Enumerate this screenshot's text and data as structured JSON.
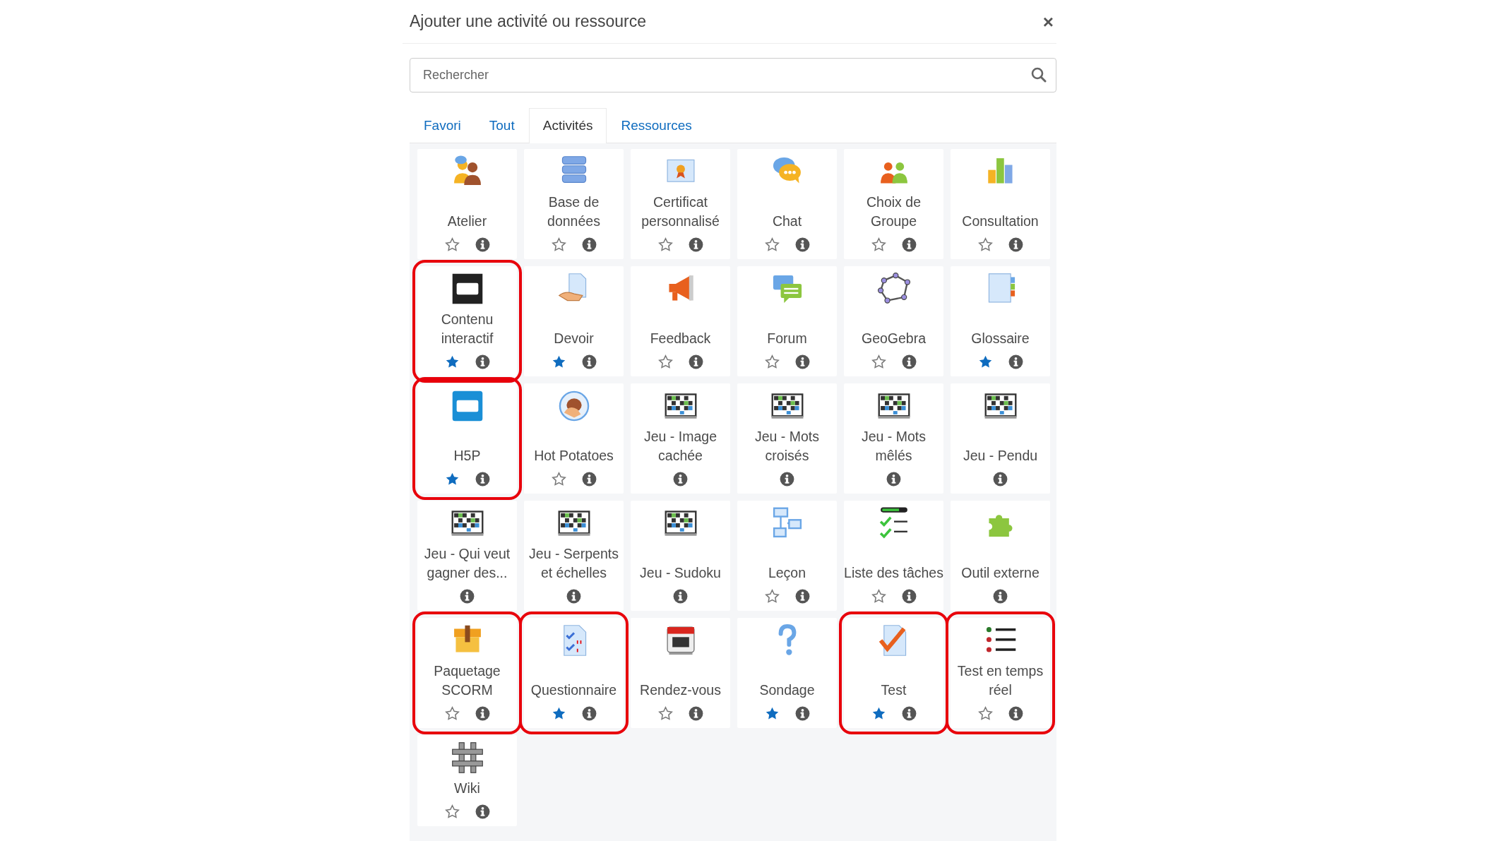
{
  "dialog": {
    "title": "Ajouter une activité ou ressource",
    "close": "×"
  },
  "search": {
    "placeholder": "Rechercher"
  },
  "tabs": [
    {
      "label": "Favori",
      "selected": false
    },
    {
      "label": "Tout",
      "selected": false
    },
    {
      "label": "Activités",
      "selected": true
    },
    {
      "label": "Ressources",
      "selected": false
    }
  ],
  "items": [
    {
      "label": "Atelier",
      "favorite": false,
      "highlighted": false
    },
    {
      "label": "Base de données",
      "favorite": false,
      "highlighted": false
    },
    {
      "label": "Certificat personnalisé",
      "favorite": false,
      "highlighted": false
    },
    {
      "label": "Chat",
      "favorite": false,
      "highlighted": false
    },
    {
      "label": "Choix de Groupe",
      "favorite": false,
      "highlighted": false
    },
    {
      "label": "Consultation",
      "favorite": false,
      "highlighted": false
    },
    {
      "label": "Contenu interactif",
      "favorite": true,
      "highlighted": true
    },
    {
      "label": "Devoir",
      "favorite": true,
      "highlighted": false
    },
    {
      "label": "Feedback",
      "favorite": false,
      "highlighted": false
    },
    {
      "label": "Forum",
      "favorite": false,
      "highlighted": false
    },
    {
      "label": "GeoGebra",
      "favorite": false,
      "highlighted": false
    },
    {
      "label": "Glossaire",
      "favorite": true,
      "highlighted": false
    },
    {
      "label": "H5P",
      "favorite": true,
      "highlighted": true
    },
    {
      "label": "Hot Potatoes",
      "favorite": false,
      "highlighted": false
    },
    {
      "label": "Jeu - Image cachée",
      "highlighted": false
    },
    {
      "label": "Jeu - Mots croisés",
      "highlighted": false
    },
    {
      "label": "Jeu - Mots mêlés",
      "highlighted": false
    },
    {
      "label": "Jeu - Pendu",
      "highlighted": false
    },
    {
      "label": "Jeu - Qui veut gagner des...",
      "highlighted": false
    },
    {
      "label": "Jeu - Serpents et échelles",
      "highlighted": false
    },
    {
      "label": "Jeu - Sudoku",
      "highlighted": false
    },
    {
      "label": "Leçon",
      "favorite": false,
      "highlighted": false
    },
    {
      "label": "Liste des tâches",
      "favorite": false,
      "highlighted": false
    },
    {
      "label": "Outil externe",
      "highlighted": false
    },
    {
      "label": "Paquetage SCORM",
      "favorite": false,
      "highlighted": true
    },
    {
      "label": "Questionnaire",
      "favorite": true,
      "highlighted": true
    },
    {
      "label": "Rendez-vous",
      "favorite": false,
      "highlighted": false
    },
    {
      "label": "Sondage",
      "favorite": true,
      "highlighted": false
    },
    {
      "label": "Test",
      "favorite": true,
      "highlighted": true
    },
    {
      "label": "Test en temps réel",
      "favorite": false,
      "highlighted": true
    },
    {
      "label": "Wiki",
      "favorite": false,
      "highlighted": false
    }
  ]
}
